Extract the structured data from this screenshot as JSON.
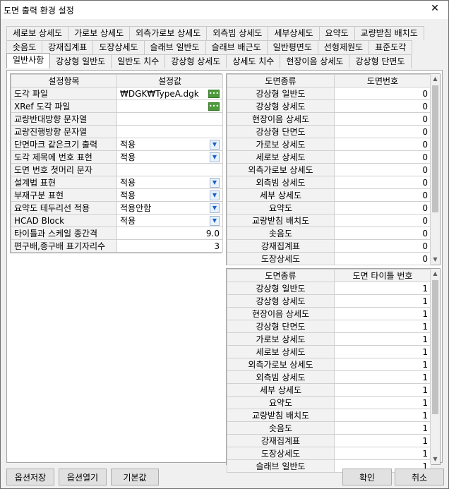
{
  "window": {
    "title": "도면 출력 환경 설정",
    "close_symbol": "✕"
  },
  "tabs": {
    "row1": [
      "세로보 상세도",
      "가로보 상세도",
      "외측가로보 상세도",
      "외측빔 상세도",
      "세부상세도",
      "요약도",
      "교량받침 배치도"
    ],
    "row2": [
      "솟음도",
      "강재집계표",
      "도장상세도",
      "슬래브 일반도",
      "슬래브 배근도",
      "일반평면도",
      "선형제원도",
      "표준도각"
    ],
    "row3": [
      "일반사항",
      "강상형 일반도",
      "일반도 치수",
      "강상형 상세도",
      "상세도 치수",
      "현장이음 상세도",
      "강상형 단면도"
    ],
    "active": "일반사항"
  },
  "settings": {
    "header_item": "설정항목",
    "header_value": "설정값",
    "rows": [
      {
        "label": "도각 파일",
        "value": "₩DGK₩TypeA.dgk",
        "control": "browse"
      },
      {
        "label": "XRef 도각 파일",
        "value": "",
        "control": "browse"
      },
      {
        "label": "교량반대방향 문자열",
        "value": "",
        "control": "none"
      },
      {
        "label": "교량진행방향 문자열",
        "value": "",
        "control": "none"
      },
      {
        "label": "단면마크 같은크기 출력",
        "value": "적용",
        "control": "dropdown"
      },
      {
        "label": "도각 제목에 번호 표현",
        "value": "적용",
        "control": "dropdown"
      },
      {
        "label": "도면 번호 첫머리 문자",
        "value": "",
        "control": "none"
      },
      {
        "label": "설계법 표현",
        "value": "적용",
        "control": "dropdown"
      },
      {
        "label": "부재구분 표현",
        "value": "적용",
        "control": "dropdown"
      },
      {
        "label": "요약도 테두리선 적용",
        "value": "적용안함",
        "control": "dropdown"
      },
      {
        "label": "HCAD Block",
        "value": "적용",
        "control": "dropdown"
      },
      {
        "label": "타이틀과 스케일 종간격",
        "value": "9.0",
        "control": "number"
      },
      {
        "label": "편구배,종구배 표기자리수",
        "value": "3",
        "control": "number"
      }
    ]
  },
  "drawing_numbers": {
    "header_type": "도면종류",
    "header_value": "도면번호",
    "rows": [
      {
        "type": "강상형 일반도",
        "value": "0"
      },
      {
        "type": "강상형 상세도",
        "value": "0"
      },
      {
        "type": "현장이음 상세도",
        "value": "0"
      },
      {
        "type": "강상형 단면도",
        "value": "0"
      },
      {
        "type": "가로보 상세도",
        "value": "0"
      },
      {
        "type": "세로보 상세도",
        "value": "0"
      },
      {
        "type": "외측가로보 상세도",
        "value": "0"
      },
      {
        "type": "외측빔 상세도",
        "value": "0"
      },
      {
        "type": "세부 상세도",
        "value": "0"
      },
      {
        "type": "요약도",
        "value": "0"
      },
      {
        "type": "교량받침 배치도",
        "value": "0"
      },
      {
        "type": "솟음도",
        "value": "0"
      },
      {
        "type": "강재집계표",
        "value": "0"
      },
      {
        "type": "도장상세도",
        "value": "0"
      }
    ]
  },
  "title_numbers": {
    "header_type": "도면종류",
    "header_value": "도면 타이틀 번호",
    "rows": [
      {
        "type": "강상형 일반도",
        "value": "1"
      },
      {
        "type": "강상형 상세도",
        "value": "1"
      },
      {
        "type": "현장이음 상세도",
        "value": "1"
      },
      {
        "type": "강상형 단면도",
        "value": "1"
      },
      {
        "type": "가로보 상세도",
        "value": "1"
      },
      {
        "type": "세로보 상세도",
        "value": "1"
      },
      {
        "type": "외측가로보 상세도",
        "value": "1"
      },
      {
        "type": "외측빔 상세도",
        "value": "1"
      },
      {
        "type": "세부 상세도",
        "value": "1"
      },
      {
        "type": "요약도",
        "value": "1"
      },
      {
        "type": "교량받침 배치도",
        "value": "1"
      },
      {
        "type": "솟음도",
        "value": "1"
      },
      {
        "type": "강재집계표",
        "value": "1"
      },
      {
        "type": "도장상세도",
        "value": "1"
      },
      {
        "type": "슬래브 일반도",
        "value": "1"
      }
    ]
  },
  "buttons": {
    "save_option": "옵션저장",
    "open_option": "옵션열기",
    "default": "기본값",
    "ok": "확인",
    "cancel": "취소"
  },
  "icons": {
    "dropdown": "chevron-down-icon",
    "browse": "ellipsis-icon",
    "scroll_up": "chevron-up-icon",
    "scroll_down": "chevron-down-icon"
  },
  "colors": {
    "browse_button": "#4c9a3b",
    "dropdown_arrow": "#1a63c7"
  }
}
